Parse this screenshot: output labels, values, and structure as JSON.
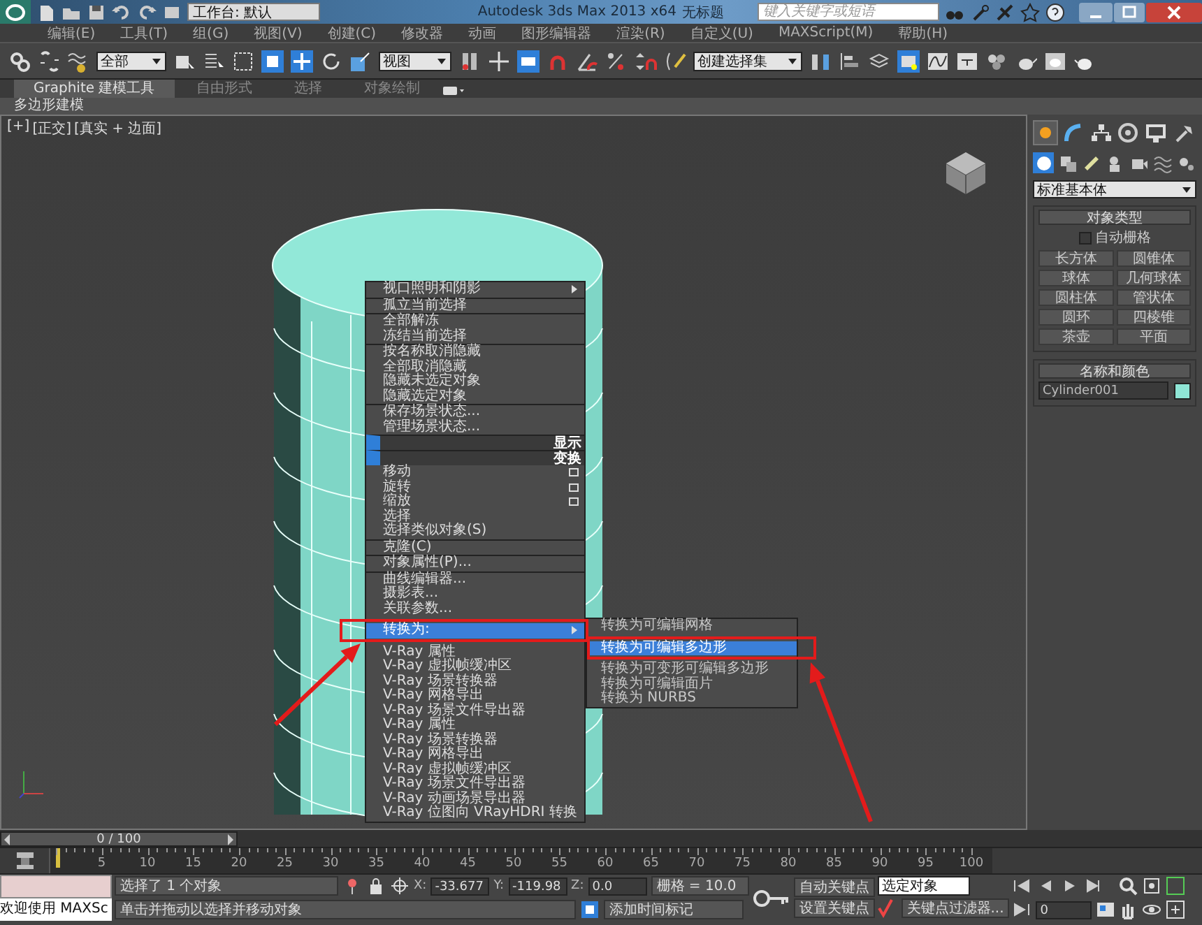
{
  "title_bar": {
    "workspace": "工作台: 默认",
    "app_title": "Autodesk 3ds Max  2013 x64",
    "document": "无标题",
    "search": {
      "placeholder": "键入关键字或短语"
    }
  },
  "menu_bar": [
    "编辑(E)",
    "工具(T)",
    "组(G)",
    "视图(V)",
    "创建(C)",
    "修改器",
    "动画",
    "图形编辑器",
    "渲染(R)",
    "自定义(U)",
    "MAXScript(M)",
    "帮助(H)"
  ],
  "toolbar": {
    "selection_filter": "全部",
    "reference_coord": "视图",
    "selection_set": "创建选择集"
  },
  "ribbon": {
    "tabs": [
      {
        "label": "Graphite 建模工具",
        "selected": true
      },
      {
        "label": "自由形式",
        "selected": false
      },
      {
        "label": "选择",
        "selected": false
      },
      {
        "label": "对象绘制",
        "selected": false
      }
    ],
    "panel": "多边形建模"
  },
  "viewport": {
    "labels": [
      "[+]",
      "[正交]",
      "[真实 + 边面]"
    ]
  },
  "context_menu": {
    "items": [
      {
        "kind": "item",
        "label": "视口照明和阴影",
        "submenu": true,
        "selected": false
      },
      {
        "kind": "separator"
      },
      {
        "kind": "item",
        "label": "孤立当前选择",
        "submenu": false,
        "selected": false
      },
      {
        "kind": "separator"
      },
      {
        "kind": "item",
        "label": "全部解冻",
        "submenu": false,
        "selected": false
      },
      {
        "kind": "item",
        "label": "冻结当前选择",
        "submenu": false,
        "selected": false
      },
      {
        "kind": "separator"
      },
      {
        "kind": "item",
        "label": "按名称取消隐藏",
        "submenu": false,
        "selected": false
      },
      {
        "kind": "item",
        "label": "全部取消隐藏",
        "submenu": false,
        "selected": false
      },
      {
        "kind": "item",
        "label": "隐藏未选定对象",
        "submenu": false,
        "selected": false
      },
      {
        "kind": "item",
        "label": "隐藏选定对象",
        "submenu": false,
        "selected": false
      },
      {
        "kind": "separator"
      },
      {
        "kind": "item",
        "label": "保存场景状态...",
        "submenu": false,
        "selected": false
      },
      {
        "kind": "item",
        "label": "管理场景状态...",
        "submenu": false,
        "selected": false
      },
      {
        "kind": "header",
        "label": "显示"
      },
      {
        "kind": "header",
        "label": "变换"
      },
      {
        "kind": "option",
        "label": "移动",
        "submenu": false,
        "selected": false
      },
      {
        "kind": "option",
        "label": "旋转",
        "submenu": false,
        "selected": false
      },
      {
        "kind": "option",
        "label": "缩放",
        "submenu": false,
        "selected": false
      },
      {
        "kind": "item",
        "label": "选择",
        "submenu": false,
        "selected": false
      },
      {
        "kind": "item",
        "label": "选择类似对象(S)",
        "submenu": false,
        "selected": false
      },
      {
        "kind": "separator"
      },
      {
        "kind": "item",
        "label": "克隆(C)",
        "submenu": false,
        "selected": false
      },
      {
        "kind": "separator"
      },
      {
        "kind": "item",
        "label": "对象属性(P)...",
        "submenu": false,
        "selected": false
      },
      {
        "kind": "separator"
      },
      {
        "kind": "item",
        "label": "曲线编辑器...",
        "submenu": false,
        "selected": false
      },
      {
        "kind": "item",
        "label": "摄影表...",
        "submenu": false,
        "selected": false
      },
      {
        "kind": "item",
        "label": "关联参数...",
        "submenu": false,
        "selected": false
      },
      {
        "kind": "item",
        "label": "转换为:",
        "submenu": true,
        "selected": true
      },
      {
        "kind": "item",
        "label": "V-Ray 属性",
        "submenu": false,
        "selected": false
      },
      {
        "kind": "item",
        "label": "V-Ray 虚拟帧缓冲区",
        "submenu": false,
        "selected": false
      },
      {
        "kind": "item",
        "label": "V-Ray 场景转换器",
        "submenu": false,
        "selected": false
      },
      {
        "kind": "item",
        "label": "V-Ray 网格导出",
        "submenu": false,
        "selected": false
      },
      {
        "kind": "item",
        "label": "V-Ray 场景文件导出器",
        "submenu": false,
        "selected": false
      },
      {
        "kind": "item",
        "label": "V-Ray 属性",
        "submenu": false,
        "selected": false
      },
      {
        "kind": "item",
        "label": "V-Ray 场景转换器",
        "submenu": false,
        "selected": false
      },
      {
        "kind": "item",
        "label": "V-Ray 网格导出",
        "submenu": false,
        "selected": false
      },
      {
        "kind": "item",
        "label": "V-Ray 虚拟帧缓冲区",
        "submenu": false,
        "selected": false
      },
      {
        "kind": "item",
        "label": "V-Ray 场景文件导出器",
        "submenu": false,
        "selected": false
      },
      {
        "kind": "item",
        "label": "V-Ray 动画场景导出器",
        "submenu": false,
        "selected": false
      },
      {
        "kind": "item",
        "label": "V-Ray 位图向 VRayHDRI 转换",
        "submenu": false,
        "selected": false
      }
    ]
  },
  "submenu": {
    "items": [
      {
        "label": "转换为可编辑网格",
        "selected": false
      },
      {
        "label": "转换为可编辑多边形",
        "selected": true
      },
      {
        "label": "转换为可变形可编辑多边形",
        "selected": false
      },
      {
        "label": "转换为可编辑面片",
        "selected": false
      },
      {
        "label": "转换为 NURBS",
        "selected": false
      }
    ]
  },
  "command_panel": {
    "tabs": [
      {
        "selected": true
      },
      {
        "selected": false
      },
      {
        "selected": false
      },
      {
        "selected": false
      },
      {
        "selected": false
      },
      {
        "selected": false
      }
    ],
    "categories": [
      {
        "selected": true
      },
      {
        "selected": false
      },
      {
        "selected": false
      },
      {
        "selected": false
      },
      {
        "selected": false
      },
      {
        "selected": false
      },
      {
        "selected": false
      }
    ],
    "category": "标准基本体",
    "object_type": {
      "title": "对象类型",
      "autogrid": {
        "label": "自动栅格",
        "checked": false
      },
      "buttons": [
        "长方体",
        "圆锥体",
        "球体",
        "几何球体",
        "圆柱体",
        "管状体",
        "圆环",
        "四棱锥",
        "茶壶",
        "平面"
      ]
    },
    "name_color": {
      "title": "名称和颜色",
      "name": "Cylinder001",
      "color": "#8fe6d6"
    }
  },
  "timeline": {
    "position": "0 / 100",
    "level": 0,
    "ticks": [
      "5",
      "10",
      "15",
      "20",
      "25",
      "30",
      "35",
      "40",
      "45",
      "50",
      "55",
      "60",
      "65",
      "70",
      "75",
      "80",
      "85",
      "90",
      "95",
      "100"
    ]
  },
  "status_bar": {
    "listener": "欢迎使用 MAXSc",
    "selection": "选择了 1 个对象",
    "prompt": "单击并拖动以选择并移动对象",
    "coords": [
      {
        "axis": "X:",
        "value": "-33.677"
      },
      {
        "axis": "Y:",
        "value": "-119.98"
      },
      {
        "axis": "Z:",
        "value": "0.0"
      }
    ],
    "grid": "栅格 = 10.0",
    "add_time_tag": "添加时间标记",
    "auto_key": "自动关键点",
    "key_mode": "选定对象",
    "set_key": "设置关键点",
    "key_filters": "关键点过滤器...",
    "frame": "0"
  }
}
